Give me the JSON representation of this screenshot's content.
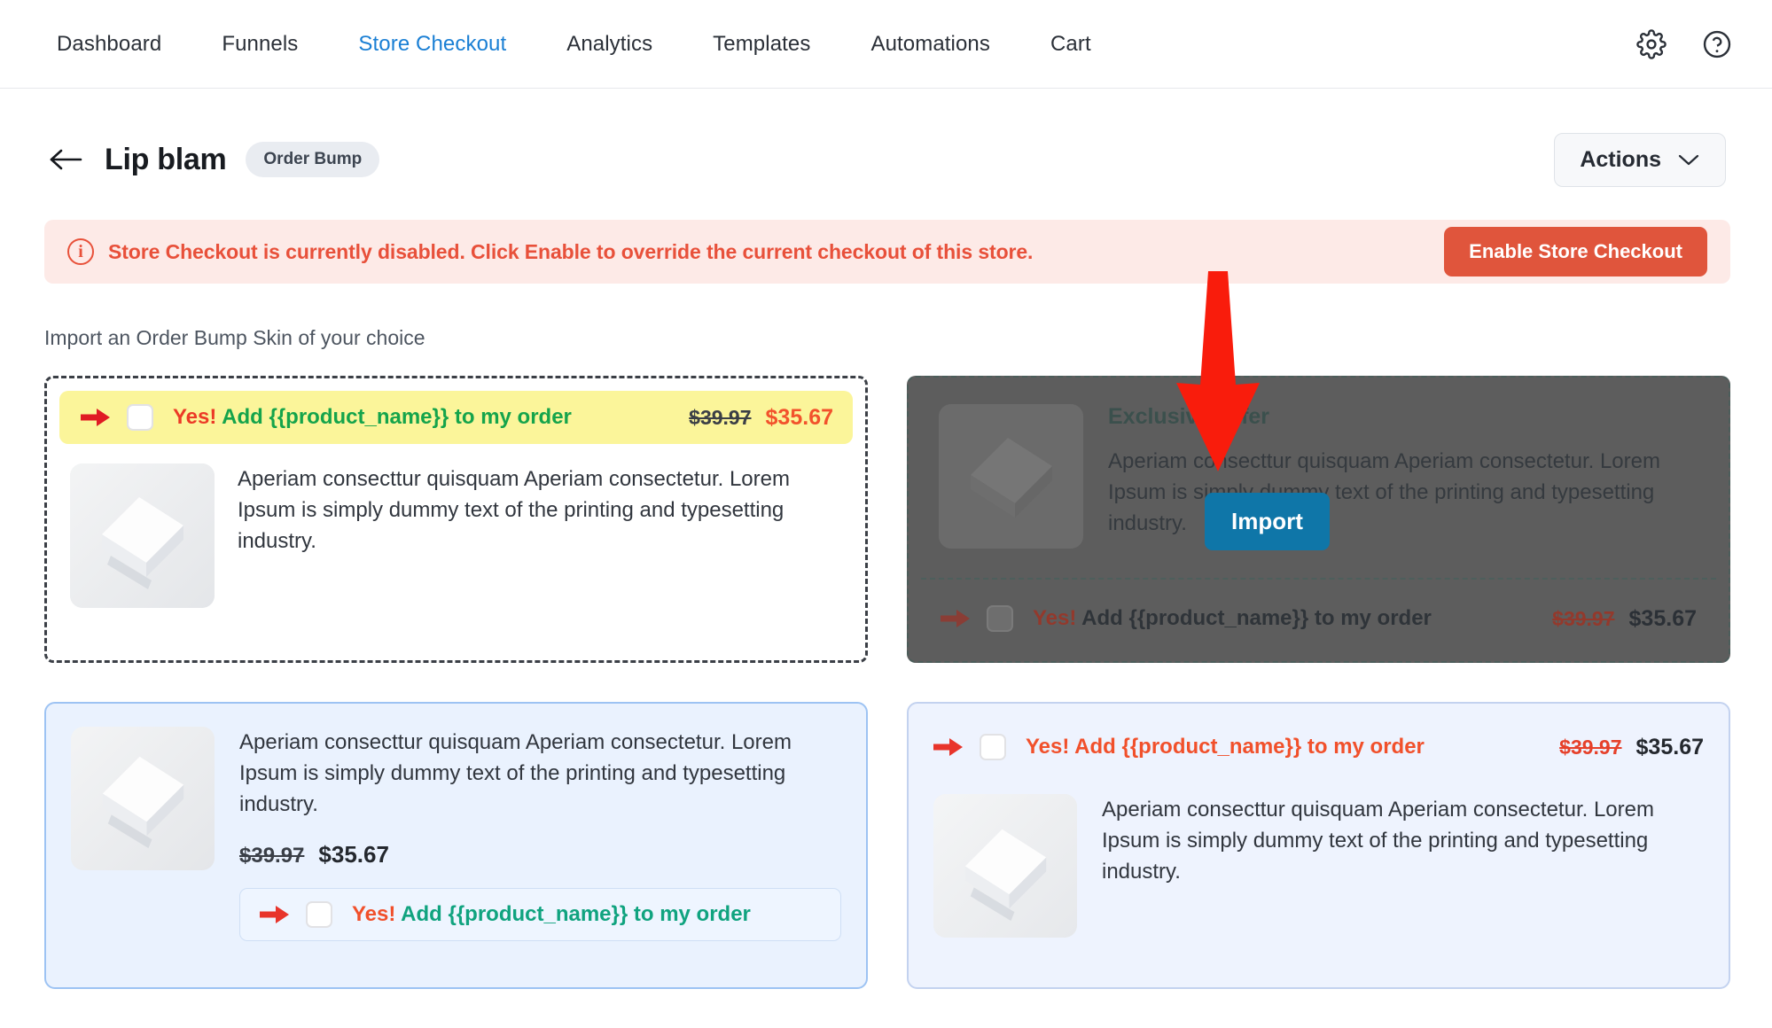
{
  "nav": {
    "items": [
      {
        "label": "Dashboard",
        "active": false
      },
      {
        "label": "Funnels",
        "active": false
      },
      {
        "label": "Store Checkout",
        "active": true
      },
      {
        "label": "Analytics",
        "active": false
      },
      {
        "label": "Templates",
        "active": false
      },
      {
        "label": "Automations",
        "active": false
      },
      {
        "label": "Cart",
        "active": false
      }
    ],
    "settings_icon": "gear-icon",
    "help_icon": "help-circle-icon"
  },
  "header": {
    "back_icon": "back-arrow-icon",
    "title": "Lip blam",
    "badge": "Order Bump",
    "actions_label": "Actions",
    "actions_caret_icon": "chevron-down-icon"
  },
  "banner": {
    "info_icon": "info-icon",
    "icon_glyph": "i",
    "message": "Store Checkout is currently disabled. Click Enable to override the current checkout of this store.",
    "button_label": "Enable Store Checkout",
    "bg_color": "#fdeae7",
    "text_color": "#e8503a",
    "button_color": "#e0553c"
  },
  "section": {
    "label": "Import an Order Bump Skin of your choice"
  },
  "overlay": {
    "import_button_label": "Import",
    "import_button_color": "#0f76a8",
    "arrow_icon": "red-down-arrow-icon",
    "arrow_color": "#f91c0c"
  },
  "skins": [
    {
      "id": "skin-yellow-highlight",
      "selected": true,
      "bump": {
        "arrow_icon": "right-arrow-icon",
        "checkbox": "unchecked-checkbox",
        "yes_text": "Yes!",
        "offer_text": "Add {{product_name}} to my order",
        "price_old": "$39.97",
        "price_new": "$35.67"
      },
      "thumb_icon": "product-box-image",
      "description": "Aperiam consecttur quisquam Aperiam consectetur. Lorem Ipsum is simply dummy text of the printing and typesetting industry."
    },
    {
      "id": "skin-exclusive-offer",
      "selected": false,
      "hovered": true,
      "title": "Exclusive Offer",
      "thumb_icon": "product-box-image",
      "description": "Aperiam consecttur quisquam Aperiam consectetur. Lorem Ipsum is simply dummy text of the printing and typesetting industry.",
      "bump": {
        "arrow_icon": "right-arrow-icon",
        "checkbox": "unchecked-checkbox",
        "yes_text": "Yes!",
        "offer_text": "Add {{product_name}} to my order",
        "price_old": "$39.97",
        "price_new": "$35.67"
      }
    },
    {
      "id": "skin-blue-card",
      "selected": false,
      "thumb_icon": "product-box-image",
      "description": "Aperiam consecttur quisquam Aperiam consectetur. Lorem Ipsum is simply dummy text of the printing and typesetting industry.",
      "price_old": "$39.97",
      "price_new": "$35.67",
      "bump": {
        "arrow_icon": "right-arrow-icon",
        "checkbox": "unchecked-checkbox",
        "yes_text": "Yes!",
        "offer_text": "Add {{product_name}} to my order"
      }
    },
    {
      "id": "skin-lavender-card",
      "selected": false,
      "bump": {
        "arrow_icon": "right-arrow-icon",
        "checkbox": "unchecked-checkbox",
        "yes_text": "Yes!",
        "offer_text": "Add {{product_name}} to my order",
        "price_old": "$39.97",
        "price_new": "$35.67"
      },
      "thumb_icon": "product-box-image",
      "description": "Aperiam consecttur quisquam Aperiam consectetur. Lorem Ipsum is simply dummy text of the printing and typesetting industry."
    }
  ]
}
